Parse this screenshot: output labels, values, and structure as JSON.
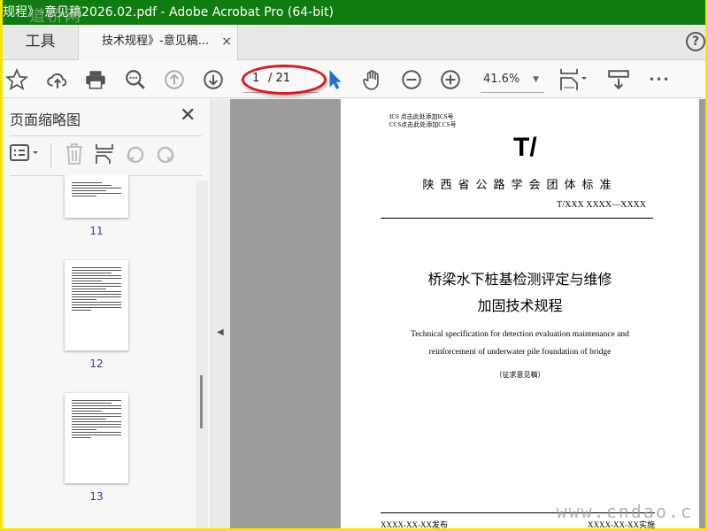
{
  "window": {
    "title": "规程》-意见稿2026.02.pdf - Adobe Acrobat Pro (64-bit)"
  },
  "watermarks": {
    "top_left": "道桥网",
    "bottom_right": "www.cndao.c"
  },
  "tabs": {
    "tools": "工具",
    "document": "技术规程》-意见稿...",
    "close": "×",
    "help": "?"
  },
  "toolbar": {
    "page_current": "1",
    "page_total": "/ 21",
    "zoom": "41.6%",
    "more": "•••"
  },
  "annotation": {
    "color": "#d81b1b"
  },
  "sidebar": {
    "title": "页面缩略图",
    "close": "✕",
    "thumbnails": [
      {
        "label": "11"
      },
      {
        "label": "12"
      },
      {
        "label": "13"
      }
    ]
  },
  "document": {
    "ics": "ICS 点击此处添加ICS号",
    "ccs": "CCS点击此处添加CCS号",
    "mark": "T/",
    "org": "陕西省公路学会团体标准",
    "code": "T/XXX XXXX—XXXX",
    "title_cn_1": "桥梁水下桩基检测评定与维修",
    "title_cn_2": "加固技术规程",
    "title_en_1": "Technical specification for detection evaluation maintenance and",
    "title_en_2": "reinforcement of underwater pile foundation of bridge",
    "draft": "（征求意见稿）",
    "publish": "XXXX-XX-XX发布",
    "implement": "XXXX-XX-XX实施"
  },
  "colors": {
    "titlebar": "#107c10",
    "frame": "#f4e600",
    "select_tool": "#1f74c9"
  }
}
